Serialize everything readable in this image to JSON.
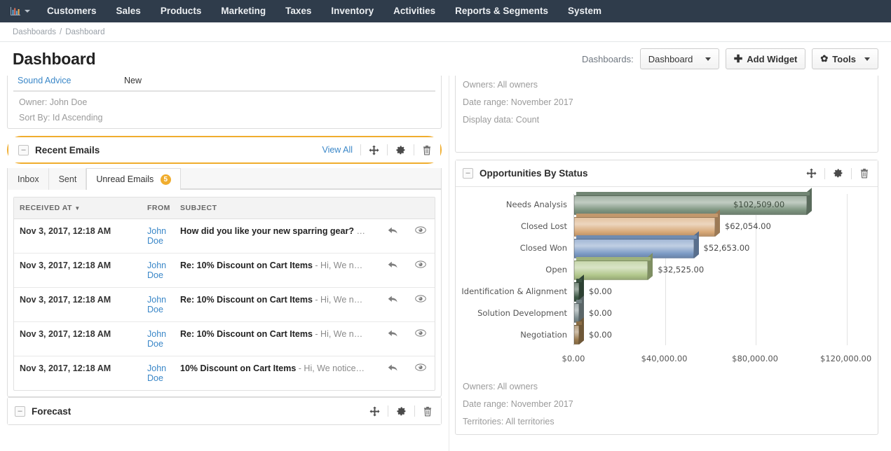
{
  "topnav": {
    "logo_icon": "bar-chart-icon",
    "items": [
      {
        "label": "Customers"
      },
      {
        "label": "Sales"
      },
      {
        "label": "Products"
      },
      {
        "label": "Marketing"
      },
      {
        "label": "Taxes"
      },
      {
        "label": "Inventory"
      },
      {
        "label": "Activities"
      },
      {
        "label": "Reports & Segments"
      },
      {
        "label": "System"
      }
    ]
  },
  "breadcrumb": {
    "root": "Dashboards",
    "sep": "/",
    "current": "Dashboard"
  },
  "page": {
    "title": "Dashboard",
    "dashboards_label": "Dashboards:",
    "dashboard_select_value": "Dashboard",
    "add_widget_label": "Add Widget",
    "add_widget_plus": "✚",
    "tools_label": "Tools",
    "tools_gear": "✿"
  },
  "left_column": {
    "partial_widget": {
      "row": {
        "name": "Sound Advice",
        "status": "New"
      },
      "owner": "Owner: John Doe",
      "sort_by": "Sort By: Id Ascending"
    },
    "recent_emails": {
      "collapse_glyph": "–",
      "title": "Recent Emails",
      "view_all": "View All",
      "move_icon": "move-icon",
      "gear_icon": "gear-icon",
      "delete_icon": "trash-icon",
      "tabs": [
        {
          "label": "Inbox",
          "active": false,
          "badge": ""
        },
        {
          "label": "Sent",
          "active": false,
          "badge": ""
        },
        {
          "label": "Unread Emails",
          "active": true,
          "badge": "5"
        }
      ],
      "columns": [
        "RECEIVED AT",
        "FROM",
        "SUBJECT"
      ],
      "sort_indicator": "▼",
      "rows": [
        {
          "received": "Nov 3, 2017, 12:18 AM",
          "from": "John Doe",
          "subject_main": "How did you like your new sparring gear?",
          "subject_preview": " …"
        },
        {
          "received": "Nov 3, 2017, 12:18 AM",
          "from": "John Doe",
          "subject_main": "Re: 10% Discount on Cart Items",
          "subject_preview": " - Hi, We n…"
        },
        {
          "received": "Nov 3, 2017, 12:18 AM",
          "from": "John Doe",
          "subject_main": "Re: 10% Discount on Cart Items",
          "subject_preview": " - Hi, We n…"
        },
        {
          "received": "Nov 3, 2017, 12:18 AM",
          "from": "John Doe",
          "subject_main": "Re: 10% Discount on Cart Items",
          "subject_preview": " - Hi, We n…"
        },
        {
          "received": "Nov 3, 2017, 12:18 AM",
          "from": "John Doe",
          "subject_main": "10% Discount on Cart Items",
          "subject_preview": " - Hi, We notice…"
        }
      ]
    },
    "forecast": {
      "collapse_glyph": "–",
      "title": "Forecast",
      "move_icon": "move-icon",
      "gear_icon": "gear-icon",
      "delete_icon": "trash-icon"
    }
  },
  "right_column": {
    "partial_widget": {
      "owners": "Owners: All owners",
      "date_range": "Date range: November 2017",
      "display_data": "Display data: Count"
    },
    "opportunities": {
      "collapse_glyph": "–",
      "title": "Opportunities By Status",
      "move_icon": "move-icon",
      "gear_icon": "gear-icon",
      "delete_icon": "trash-icon",
      "footer": {
        "owners": "Owners: All owners",
        "date_range": "Date range: November 2017",
        "territories": "Territories: All territories"
      }
    }
  },
  "chart_data": {
    "type": "bar",
    "orientation": "horizontal",
    "title": "Opportunities By Status",
    "xlabel": "",
    "ylabel": "",
    "categories": [
      "Needs Analysis",
      "Closed Lost",
      "Closed Won",
      "Open",
      "Identification & Alignment",
      "Solution Development",
      "Negotiation"
    ],
    "values": [
      102509.0,
      62054.0,
      52653.0,
      32525.0,
      0.0,
      0.0,
      0.0
    ],
    "data_labels": [
      "$102,509.00",
      "$62,054.00",
      "$52,653.00",
      "$32,525.00",
      "$0.00",
      "$0.00",
      "$0.00"
    ],
    "bar_colors": [
      "#7d9480",
      "#d8a978",
      "#7b9ac4",
      "#b0c68a",
      "#3f5a47",
      "#7e8e90",
      "#9a7a4e"
    ],
    "xlim": [
      0,
      130000
    ],
    "xticks": [
      0,
      40000,
      80000,
      120000
    ],
    "xticklabels": [
      "$0.00",
      "$40,000.00",
      "$80,000.00",
      "$120,000.00"
    ],
    "grid": true,
    "legend": false
  }
}
